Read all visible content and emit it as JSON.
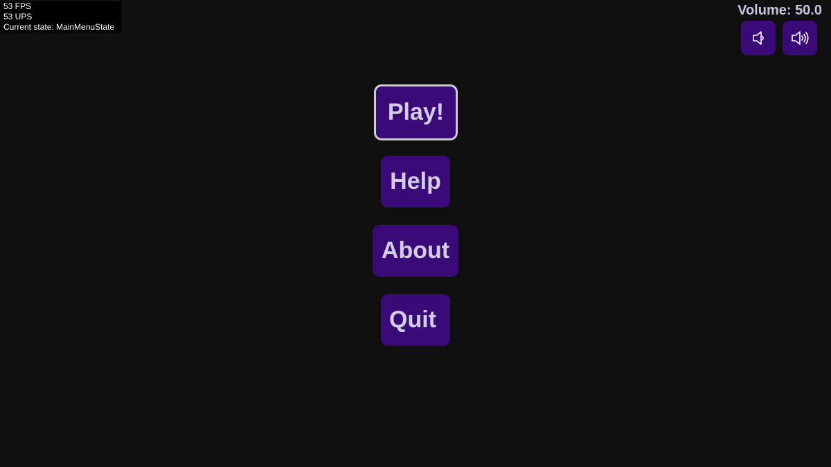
{
  "debug": {
    "fps": "53 FPS",
    "ups": "53 UPS",
    "state": "Current state: MainMenuState"
  },
  "volume": {
    "label": "Volume: 50.0",
    "down_icon": "speaker-low-icon",
    "up_icon": "speaker-high-icon"
  },
  "menu": {
    "play": "Play!",
    "help": "Help",
    "about": "About",
    "quit": "Quit"
  },
  "colors": {
    "background": "#0f0f0f",
    "button": "#3a0b78",
    "button_text": "#d3cde6",
    "selected_border": "#cfcad9"
  }
}
